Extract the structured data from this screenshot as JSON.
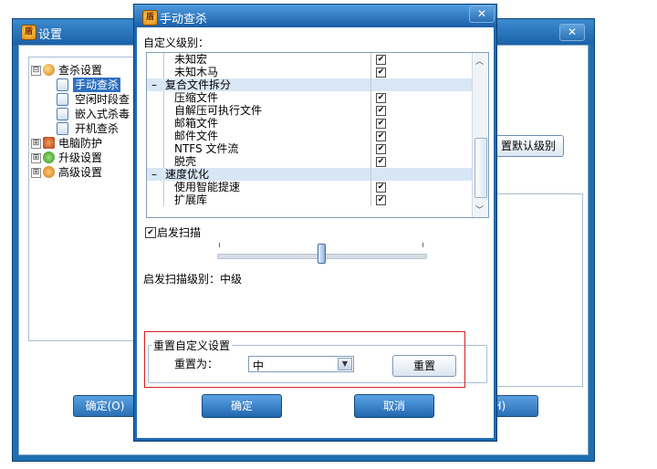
{
  "background_window": {
    "title": "设置",
    "tree": [
      {
        "label": "查杀设置",
        "icon": "search-icon",
        "expand": "⊟"
      },
      {
        "label": "手动查杀",
        "icon": "doc-icon",
        "selected": true
      },
      {
        "label": "空闲时段查",
        "icon": "doc-icon"
      },
      {
        "label": "嵌入式杀毒",
        "icon": "doc-icon"
      },
      {
        "label": "开机查杀",
        "icon": "doc-icon"
      },
      {
        "label": "电脑防护",
        "icon": "pc-guard-icon",
        "expand": "⊞"
      },
      {
        "label": "升级设置",
        "icon": "upgrade-icon",
        "expand": "⊞"
      },
      {
        "label": "高级设置",
        "icon": "advanced-icon",
        "expand": "⊞"
      }
    ],
    "restore_default_label": "置默认级别",
    "ok_label": "确定(O)",
    "help_label": "(H)"
  },
  "dialog": {
    "title": "手动查杀",
    "close_glyph": "✕",
    "custom_level_label": "自定义级别：",
    "rows": [
      {
        "type": "item",
        "label": "未知宏",
        "checked": true
      },
      {
        "type": "item",
        "label": "未知木马",
        "checked": true
      },
      {
        "type": "group",
        "label": "复合文件拆分"
      },
      {
        "type": "item",
        "label": "压缩文件",
        "checked": true
      },
      {
        "type": "item",
        "label": "自解压可执行文件",
        "checked": true
      },
      {
        "type": "item",
        "label": "邮箱文件",
        "checked": true
      },
      {
        "type": "item",
        "label": "邮件文件",
        "checked": true
      },
      {
        "type": "item",
        "label": "NTFS 文件流",
        "checked": true
      },
      {
        "type": "item",
        "label": "脱壳",
        "checked": true
      },
      {
        "type": "group",
        "label": "速度优化"
      },
      {
        "type": "item",
        "label": "使用智能提速",
        "checked": true
      },
      {
        "type": "item",
        "label": "扩展库",
        "checked": true
      }
    ],
    "heuristic_label": "启发扫描",
    "heuristic_checked": true,
    "heuristic_level_fraction": 0.5,
    "heuristic_level_text": "启发扫描级别：中级",
    "reset_group_title": "重置自定义设置",
    "reset_to_label": "重置为：",
    "reset_to_value": "中",
    "reset_button": "重置",
    "ok_button": "确定",
    "cancel_button": "取消"
  },
  "colors": {
    "window_blue": "#1e69b3",
    "highlight": "#d42020"
  }
}
